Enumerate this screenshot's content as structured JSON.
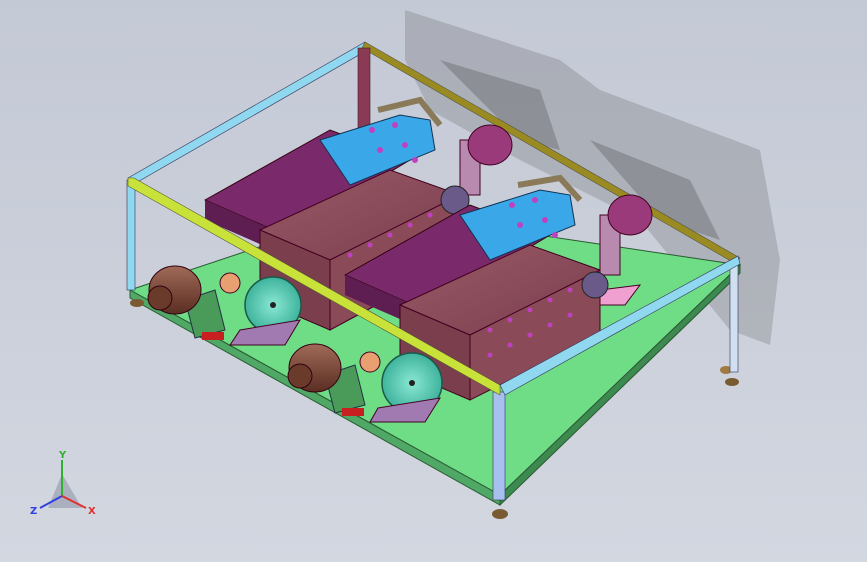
{
  "viewport": {
    "background_top": "#c4c9d6",
    "background_bottom": "#d3d7e0"
  },
  "colors": {
    "base_plate": "#6fdc86",
    "frame_yellow_green": "#c8e23a",
    "frame_cyan": "#8fd8f0",
    "frame_olive": "#9a8a22",
    "frame_maroon": "#8a3a55",
    "housing_brown": "#8a4a58",
    "plate_purple": "#7a2a6a",
    "bracket_blue": "#3aa8e8",
    "gear_teal": "#5fd0b8",
    "motor_brown": "#7a4a3a",
    "pink_block": "#f0a0d0"
  },
  "triad": {
    "x_label": "X",
    "y_label": "Y",
    "z_label": "Z",
    "x_color": "#e03030",
    "y_color": "#30b030",
    "z_color": "#3040e0"
  }
}
